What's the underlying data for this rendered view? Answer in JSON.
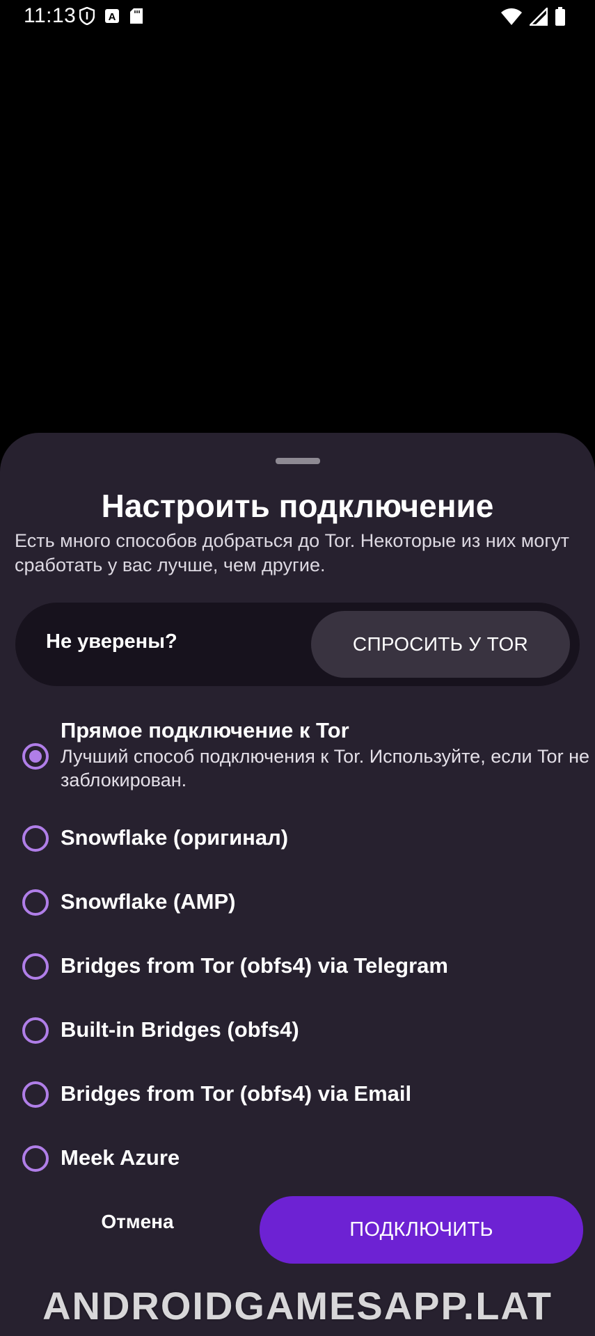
{
  "status_bar": {
    "time": "11:13",
    "left_icons": [
      "vpn-shield-icon",
      "keyboard-a-icon",
      "sd-card-icon"
    ],
    "right_icons": [
      "wifi-icon",
      "cellular-signal-icon",
      "battery-icon"
    ]
  },
  "sheet": {
    "title": "Настроить подключение",
    "description": "Есть много способов добраться до Tor. Некоторые из них могут сработать у вас лучше, чем другие.",
    "ask": {
      "label": "Не уверены?",
      "button": "СПРОСИТЬ У TOR"
    },
    "options": [
      {
        "title": "Прямое подключение к Tor",
        "subtitle": "Лучший способ подключения к Tor. Используйте, если Tor не заблокирован.",
        "checked": true
      },
      {
        "title": "Snowflake (оригинал)",
        "checked": false
      },
      {
        "title": "Snowflake (AMP)",
        "checked": false
      },
      {
        "title": "Bridges from Tor (obfs4) via Telegram",
        "checked": false
      },
      {
        "title": "Built-in Bridges (obfs4)",
        "checked": false
      },
      {
        "title": "Bridges from Tor (obfs4) via Email",
        "checked": false
      },
      {
        "title": "Meek Azure",
        "checked": false
      }
    ],
    "cancel_label": "Отмена",
    "connect_label": "ПОДКЛЮЧИТЬ"
  },
  "watermark": "ANDROIDGAMESAPP.LAT",
  "colors": {
    "sheet_background": "#27212f",
    "accent_purple": "#6d22d3",
    "radio_purple": "#b07ee8"
  }
}
